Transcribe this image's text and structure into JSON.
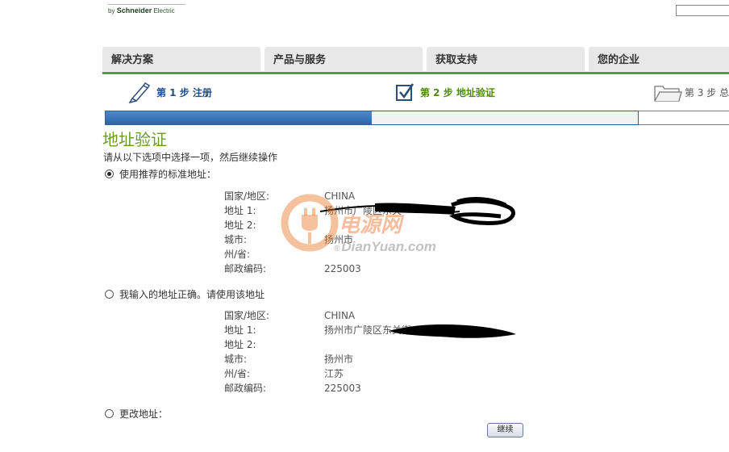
{
  "header": {
    "logo_prefix": "by",
    "logo_brand": "Schneider",
    "logo_suffix": "Electric",
    "search_placeholder": ""
  },
  "nav": {
    "tabs": [
      {
        "label": "解决方案"
      },
      {
        "label": "产品与服务"
      },
      {
        "label": "获取支持"
      },
      {
        "label": "您的企业"
      }
    ]
  },
  "steps": [
    {
      "label": "第 1 步 注册",
      "color": "#1f4f8a"
    },
    {
      "label": "第 2 步 地址验证",
      "color": "#4f8a10"
    },
    {
      "label": "第 3 步 总",
      "color": "#555555"
    }
  ],
  "progress": {
    "percent": 50
  },
  "page_title": "地址验证",
  "instruction": "请从以下选项中选择一项，然后继续操作",
  "options": [
    {
      "label": "使用推荐的标准地址：",
      "checked": true,
      "fields": [
        {
          "label": "国家/地区:",
          "value": "CHINA"
        },
        {
          "label": "地址 1:",
          "value": "扬州市广陵区东关"
        },
        {
          "label": "地址 2:",
          "value": ""
        },
        {
          "label": "城市:",
          "value": "扬州市"
        },
        {
          "label": "州/省:",
          "value": ""
        },
        {
          "label": "邮政编码:",
          "value": "225003"
        }
      ]
    },
    {
      "label": "我输入的地址正确。请使用该地址",
      "checked": false,
      "fields": [
        {
          "label": "国家/地区:",
          "value": "CHINA"
        },
        {
          "label": "地址 1:",
          "value": "扬州市广陵区东关街"
        },
        {
          "label": "地址 2:",
          "value": ""
        },
        {
          "label": "城市:",
          "value": "扬州市"
        },
        {
          "label": "州/省:",
          "value": "江苏"
        },
        {
          "label": "邮政编码:",
          "value": "225003"
        }
      ]
    },
    {
      "label": "更改地址：",
      "checked": false,
      "fields": []
    }
  ],
  "continue_label": "继续",
  "watermark": {
    "text_cn": "电源网",
    "text_en": "DianYuan.com",
    "registered": "®"
  },
  "colors": {
    "accent_green": "#3fa82f",
    "title_green": "#6a9a2a",
    "progress_blue": "#2d66a8"
  }
}
